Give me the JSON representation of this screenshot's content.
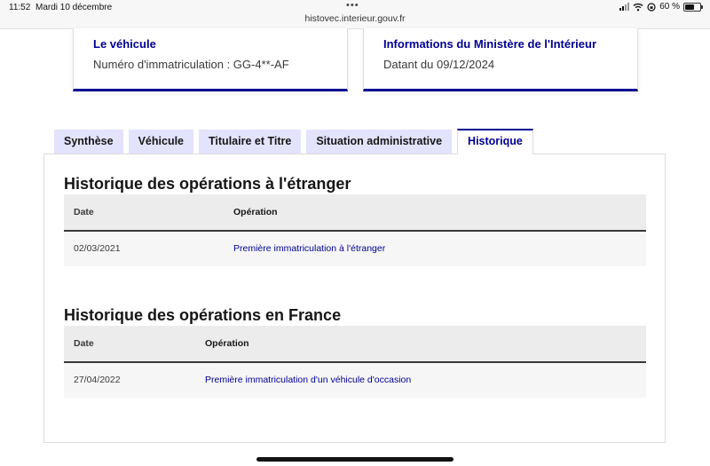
{
  "status_bar": {
    "time": "11:52",
    "date": "Mardi 10 décembre",
    "dots": "•••",
    "url": "histovec.interieur.gouv.fr",
    "battery": "60 %",
    "battery_fraction": 0.6
  },
  "cards": [
    {
      "title": "Le véhicule",
      "text": "Numéro d'immatriculation : GG-4**-AF"
    },
    {
      "title": "Informations du Ministère de l'Intérieur",
      "text": "Datant du 09/12/2024"
    }
  ],
  "tabs": [
    {
      "label": "Synthèse",
      "active": false
    },
    {
      "label": "Véhicule",
      "active": false
    },
    {
      "label": "Titulaire et Titre",
      "active": false
    },
    {
      "label": "Situation administrative",
      "active": false
    },
    {
      "label": "Historique",
      "active": true
    }
  ],
  "sections": [
    {
      "title": "Historique des opérations à l'étranger",
      "columns": [
        "Date",
        "Opération"
      ],
      "rows": [
        {
          "date": "02/03/2021",
          "operation": "Première immatriculation à l'étranger"
        }
      ]
    },
    {
      "title": "Historique des opérations en France",
      "columns": [
        "Date",
        "Opération"
      ],
      "rows": [
        {
          "date": "27/04/2022",
          "operation": "Première immatriculation d'un véhicule d'occasion"
        }
      ]
    }
  ],
  "colors": {
    "accent": "#000091",
    "tab_bg": "#e3e3fd",
    "header_bg": "#ececec",
    "row_bg": "#f6f6f6"
  }
}
